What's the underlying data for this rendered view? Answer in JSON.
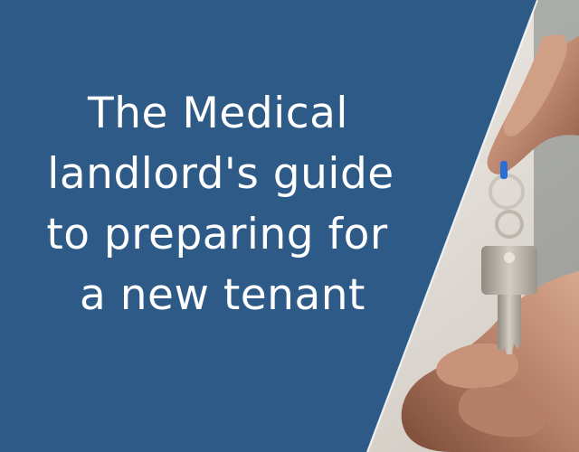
{
  "headline": {
    "lines": [
      "The Medical",
      "landlord's guide",
      "to preparing for",
      "a new tenant"
    ]
  },
  "colors": {
    "panel": "#2e5a87",
    "text": "#ffffff",
    "skin": "#c99a83",
    "key": "#b8b1a7",
    "photo_background": "#e9e6e2"
  },
  "photo": {
    "subject": "hand-handing-over-key-photo"
  }
}
